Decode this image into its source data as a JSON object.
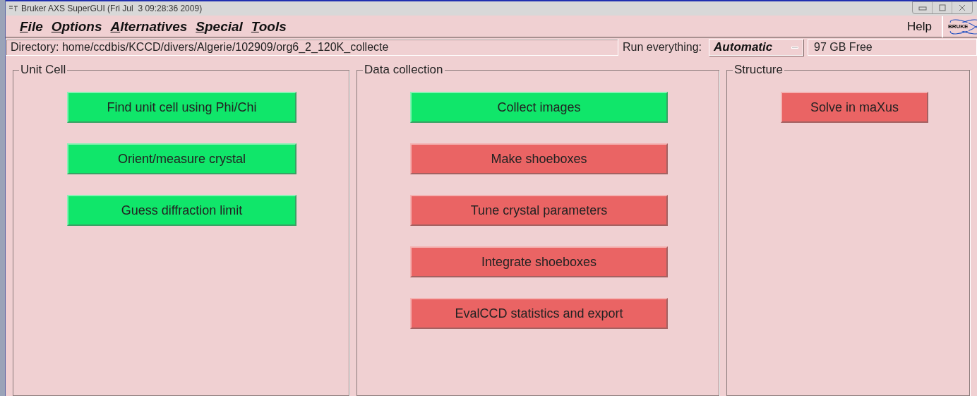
{
  "window": {
    "title": "Bruker AXS SuperGUI (Fri Jul  3 09:28:36 2009)"
  },
  "menu": [
    {
      "label": "File"
    },
    {
      "label": "Options"
    },
    {
      "label": "Alternatives"
    },
    {
      "label": "Special"
    },
    {
      "label": "Tools"
    }
  ],
  "help": "Help",
  "logo_text": "BRUKE",
  "directory": "Directory: home/ccdbis/KCCD/divers/Algerie/102909/org6_2_120K_collecte",
  "run_label": "Run everything:",
  "run_mode": "Automatic",
  "free_space": "97 GB Free",
  "panels": [
    {
      "title": "Unit Cell",
      "buttons": [
        {
          "label": "Find unit cell using Phi/Chi",
          "done": true
        },
        {
          "label": "Orient/measure crystal",
          "done": true
        },
        {
          "label": "Guess diffraction limit",
          "done": true
        }
      ]
    },
    {
      "title": "Data collection",
      "buttons": [
        {
          "label": "Collect images",
          "done": true
        },
        {
          "label": "Make shoeboxes",
          "done": false
        },
        {
          "label": "Tune crystal parameters",
          "done": false
        },
        {
          "label": "Integrate shoeboxes",
          "done": false
        },
        {
          "label": "EvalCCD statistics and export",
          "done": false
        }
      ]
    },
    {
      "title": "Structure",
      "buttons": [
        {
          "label": "Solve in maXus",
          "done": false
        }
      ]
    }
  ]
}
